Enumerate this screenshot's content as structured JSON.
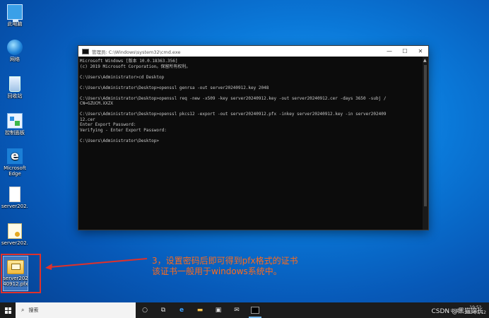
{
  "desktop": {
    "icons": [
      {
        "label": "此电脑",
        "icon": "computer-icon"
      },
      {
        "label": "网络",
        "icon": "network-icon"
      },
      {
        "label": "回收站",
        "icon": "recycle-bin-icon"
      },
      {
        "label": "控制面板",
        "icon": "control-panel-icon"
      },
      {
        "label": "Microsoft Edge",
        "icon": "edge-icon"
      },
      {
        "label": "server202...",
        "icon": "document-icon"
      },
      {
        "label": "server202...",
        "icon": "certificate-icon"
      },
      {
        "label": "server20240912.pfx",
        "icon": "pfx-file-icon"
      }
    ]
  },
  "cmd": {
    "title": "管理员: C:\\Windows\\system32\\cmd.exe",
    "lines": [
      "Microsoft Windows [版本 10.0.18363.356]",
      "(c) 2019 Microsoft Corporation。保留所有权利。",
      "",
      "C:\\Users\\Administrator>cd Desktop",
      "",
      "C:\\Users\\Administrator\\Desktop>openssl genrsa -out server20240912.key 2048",
      "",
      "C:\\Users\\Administrator\\Desktop>openssl req -new -x509 -key server20240912.key -out server20240912.cer -days 3650 -subj /",
      "CN=GZUCM.XXZX",
      "",
      "C:\\Users\\Administrator\\Desktop>openssl pkcs12 -export -out server20240912.pfx -inkey server20240912.key -in server202409",
      "12.cer",
      "Enter Export Password:",
      "Verifying - Enter Export Password:",
      "",
      "C:\\Users\\Administrator\\Desktop>"
    ],
    "minimize": "—",
    "maximize": "☐",
    "close": "✕"
  },
  "annotation": {
    "line1": "3，设置密码后即可得到pfx格式的证书",
    "line2": "该证书一般用于windows系统中。"
  },
  "taskbar": {
    "search_placeholder": "搜索",
    "clock_time": "19:5?",
    "clock_date": "2024/9/12",
    "tray_text": "へ 中 英"
  },
  "watermark": "CSDN @黑猫锦长"
}
